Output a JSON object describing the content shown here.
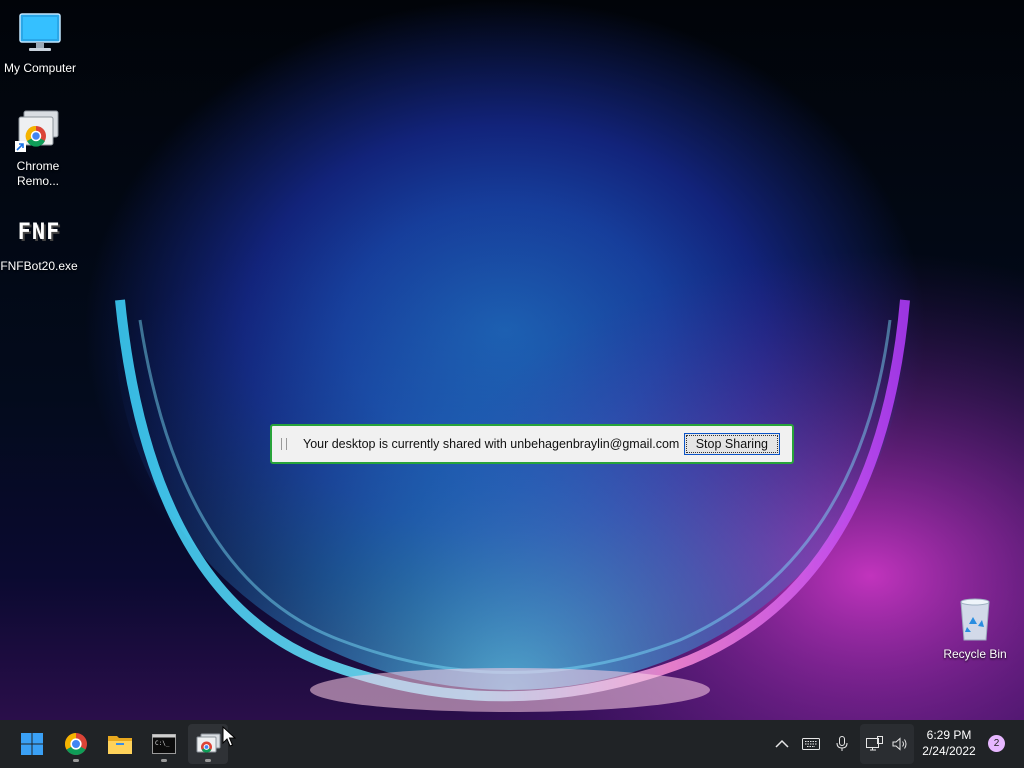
{
  "desktop": {
    "icons": [
      {
        "label": "My Computer"
      },
      {
        "label": "Chrome Remo..."
      },
      {
        "label": "FNFBot20.exe",
        "glyph": "FNF"
      },
      {
        "label": "Recycle Bin"
      }
    ]
  },
  "share_bar": {
    "message": "Your desktop is currently shared with unbehagenbraylin@gmail.com",
    "stop_label": "Stop Sharing",
    "border_color": "#28a33a"
  },
  "taskbar": {
    "apps": [
      "start-icon",
      "chrome-icon",
      "file-explorer-icon",
      "terminal-icon",
      "chrome-remote-desktop-icon"
    ],
    "tray_icons": [
      "chevron-up-icon",
      "keyboard-icon",
      "microphone-icon",
      "network-icon",
      "volume-icon"
    ],
    "time": "6:29 PM",
    "date": "2/24/2022",
    "notification_count": "2",
    "background": "#202326"
  }
}
